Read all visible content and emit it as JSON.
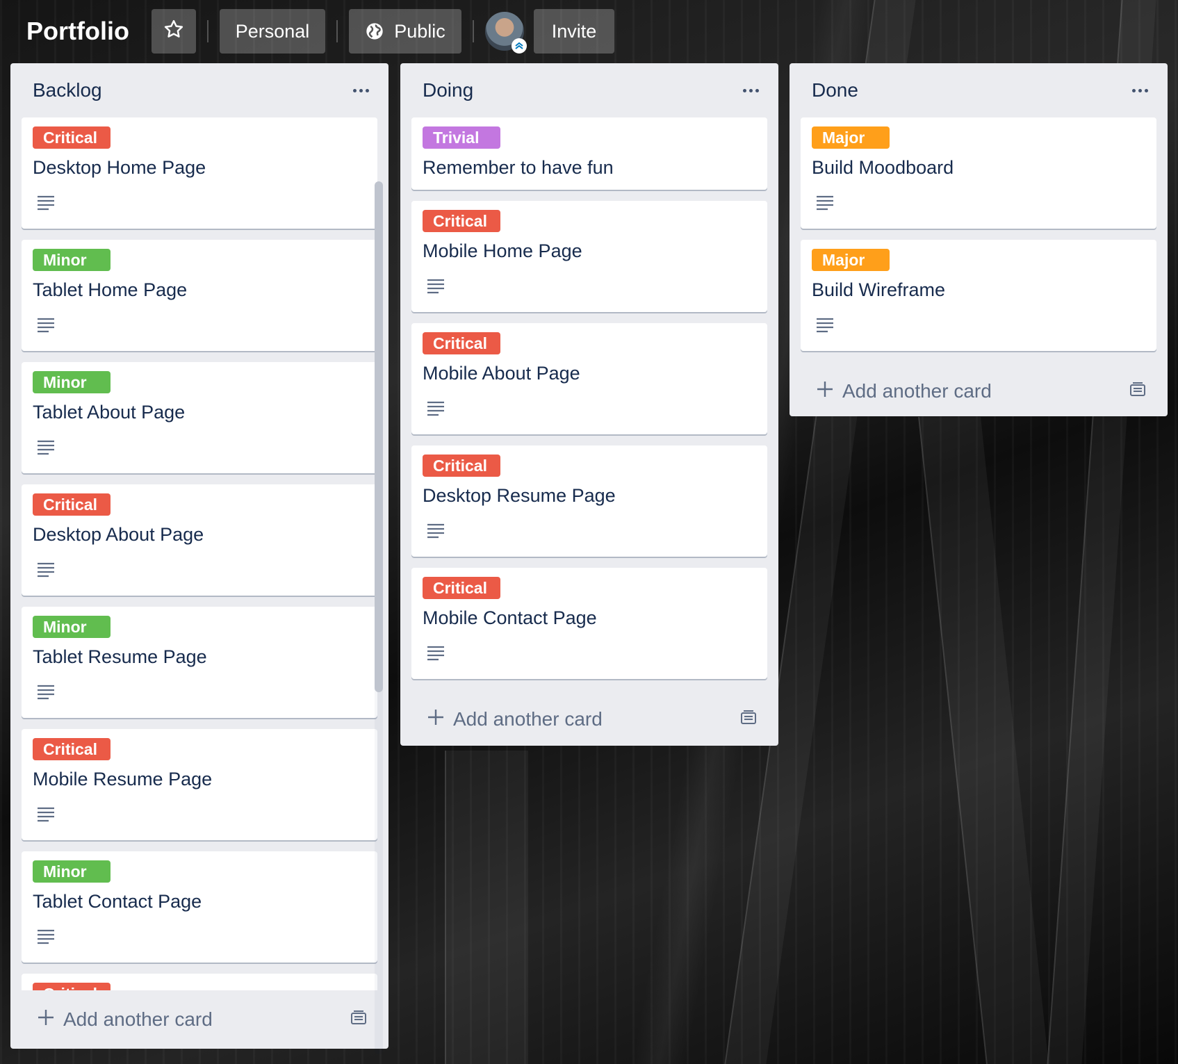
{
  "board": {
    "title": "Portfolio",
    "visibility_team": "Personal",
    "visibility": "Public",
    "invite_label": "Invite"
  },
  "colors": {
    "critical": "#eb5a46",
    "minor": "#61bd4f",
    "trivial": "#c377e0",
    "major": "#ff9f1a"
  },
  "lists": [
    {
      "title": "Backlog",
      "add_label": "Add another card",
      "cards": [
        {
          "label": "Critical",
          "title": "Desktop Home Page"
        },
        {
          "label": "Minor",
          "title": "Tablet Home Page"
        },
        {
          "label": "Minor",
          "title": "Tablet About Page"
        },
        {
          "label": "Critical",
          "title": "Desktop About Page"
        },
        {
          "label": "Minor",
          "title": "Tablet Resume Page"
        },
        {
          "label": "Critical",
          "title": "Mobile Resume Page"
        },
        {
          "label": "Minor",
          "title": "Tablet Contact Page"
        },
        {
          "label": "Critical",
          "title": ""
        }
      ]
    },
    {
      "title": "Doing",
      "add_label": "Add another card",
      "cards": [
        {
          "label": "Trivial",
          "title": "Remember to have fun"
        },
        {
          "label": "Critical",
          "title": "Mobile Home Page"
        },
        {
          "label": "Critical",
          "title": "Mobile About Page"
        },
        {
          "label": "Critical",
          "title": "Desktop Resume Page"
        },
        {
          "label": "Critical",
          "title": "Mobile Contact Page"
        }
      ]
    },
    {
      "title": "Done",
      "add_label": "Add another card",
      "cards": [
        {
          "label": "Major",
          "title": "Build Moodboard"
        },
        {
          "label": "Major",
          "title": "Build Wireframe"
        }
      ]
    }
  ]
}
